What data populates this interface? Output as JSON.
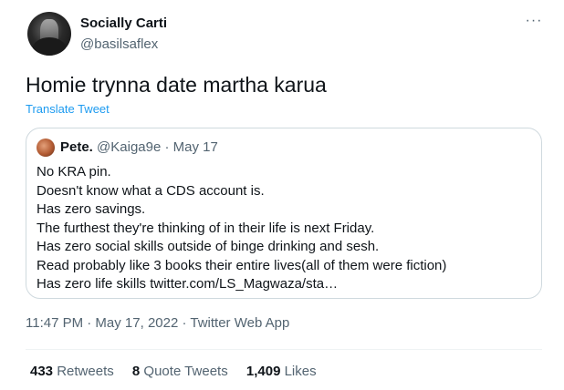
{
  "author": {
    "name": "Socially Carti",
    "handle": "@basilsaflex"
  },
  "more_icon": "more-horizontal-icon",
  "tweet_text": "Homie trynna date martha karua",
  "translate_label": "Translate Tweet",
  "quoted": {
    "name": "Pete.",
    "handle": "@Kaiga9e",
    "separator": "·",
    "date": "May 17",
    "lines": [
      "No KRA pin.",
      "Doesn't know what a CDS account is.",
      "Has zero savings.",
      "The furthest they're thinking of in their life is next Friday.",
      "Has zero social skills outside of binge drinking and sesh.",
      "Read probably like 3 books their entire lives(all of them were fiction)",
      "Has zero life skills twitter.com/LS_Magwaza/sta…"
    ]
  },
  "meta": "11:47 PM · May 17, 2022 · Twitter Web App",
  "stats": {
    "retweets_count": "433",
    "retweets_label": "Retweets",
    "quotes_count": "8",
    "quotes_label": "Quote Tweets",
    "likes_count": "1,409",
    "likes_label": "Likes"
  },
  "colors": {
    "link": "#1d9bf0",
    "secondary_text": "#536471",
    "border": "#cfd9de"
  }
}
